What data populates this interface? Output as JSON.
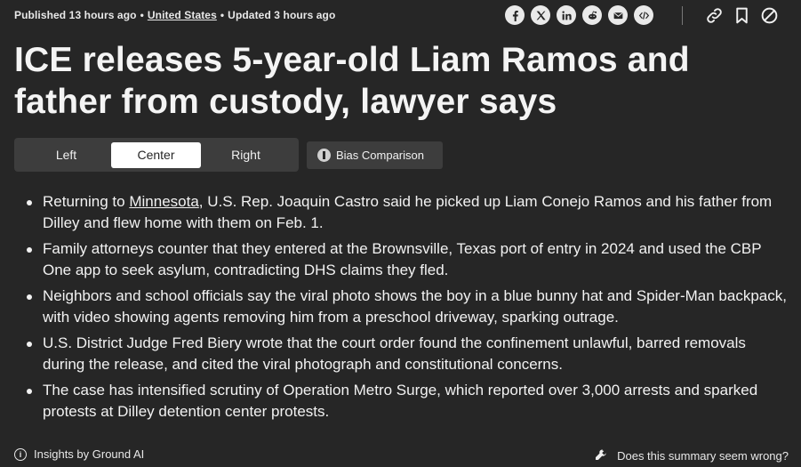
{
  "meta": {
    "published": "Published 13 hours ago",
    "sep1": "•",
    "location": "United States",
    "sep2": "•",
    "updated": "Updated 3 hours ago"
  },
  "share_icons": [
    "facebook-icon",
    "x-icon",
    "linkedin-icon",
    "reddit-icon",
    "email-icon",
    "embed-icon"
  ],
  "tool_icons": [
    "link-icon",
    "bookmark-icon",
    "block-icon"
  ],
  "headline": "ICE releases 5-year-old Liam Ramos and father from custody, lawyer says",
  "tabs": [
    {
      "label": "Left"
    },
    {
      "label": "Center"
    },
    {
      "label": "Right"
    }
  ],
  "active_tab": "Center",
  "bias_button": "Bias Comparison",
  "bullets": {
    "b1_pre": "Returning to ",
    "b1_link": "Minnesota",
    "b1_post": ", U.S. Rep. Joaquin Castro said he picked up Liam Conejo Ramos and his father from Dilley and flew home with them on Feb. 1.",
    "b2": "Family attorneys counter that they entered at the Brownsville, Texas port of entry in 2024 and used the CBP One app to seek asylum, contradicting DHS claims they fled.",
    "b3": "Neighbors and school officials say the viral photo shows the boy in a blue bunny hat and Spider-Man backpack, with video showing agents removing him from a preschool driveway, sparking outrage.",
    "b4": "U.S. District Judge Fred Biery wrote that the court order found the confinement unlawful, barred removals during the release, and cited the viral photograph and constitutional concerns.",
    "b5": "The case has intensified scrutiny of Operation Metro Surge, which reported over 3,000 arrests and sparked protests at Dilley detention center protests."
  },
  "footer": {
    "insights": "Insights by Ground AI",
    "feedback": "Does this summary seem wrong?"
  },
  "colors": {
    "background": "#262626",
    "panel": "#3d3d3d",
    "text": "#f2f2f2"
  }
}
